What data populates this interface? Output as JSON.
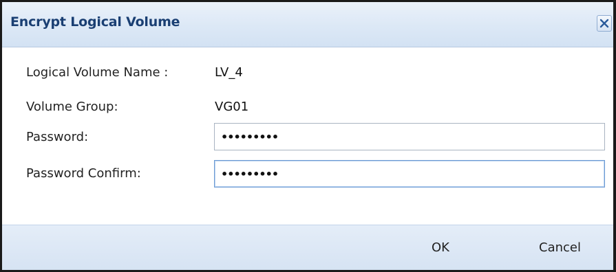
{
  "dialog": {
    "title": "Encrypt Logical Volume",
    "close_icon": "close-x-icon"
  },
  "form": {
    "lv_name_label": "Logical Volume Name :",
    "lv_name_value": "LV_4",
    "volume_group_label": "Volume Group:",
    "volume_group_value": "VG01",
    "password_label": "Password:",
    "password_value": "•••••••••",
    "password_confirm_label": "Password Confirm:",
    "password_confirm_value": "•••••••••"
  },
  "buttons": {
    "ok_label": "OK",
    "cancel_label": "Cancel"
  },
  "colors": {
    "title_text": "#1a3f73",
    "titlebar_bg": "#dce8f6",
    "footer_bg": "#d6e3f3",
    "focus_border": "#6d9bd4"
  }
}
